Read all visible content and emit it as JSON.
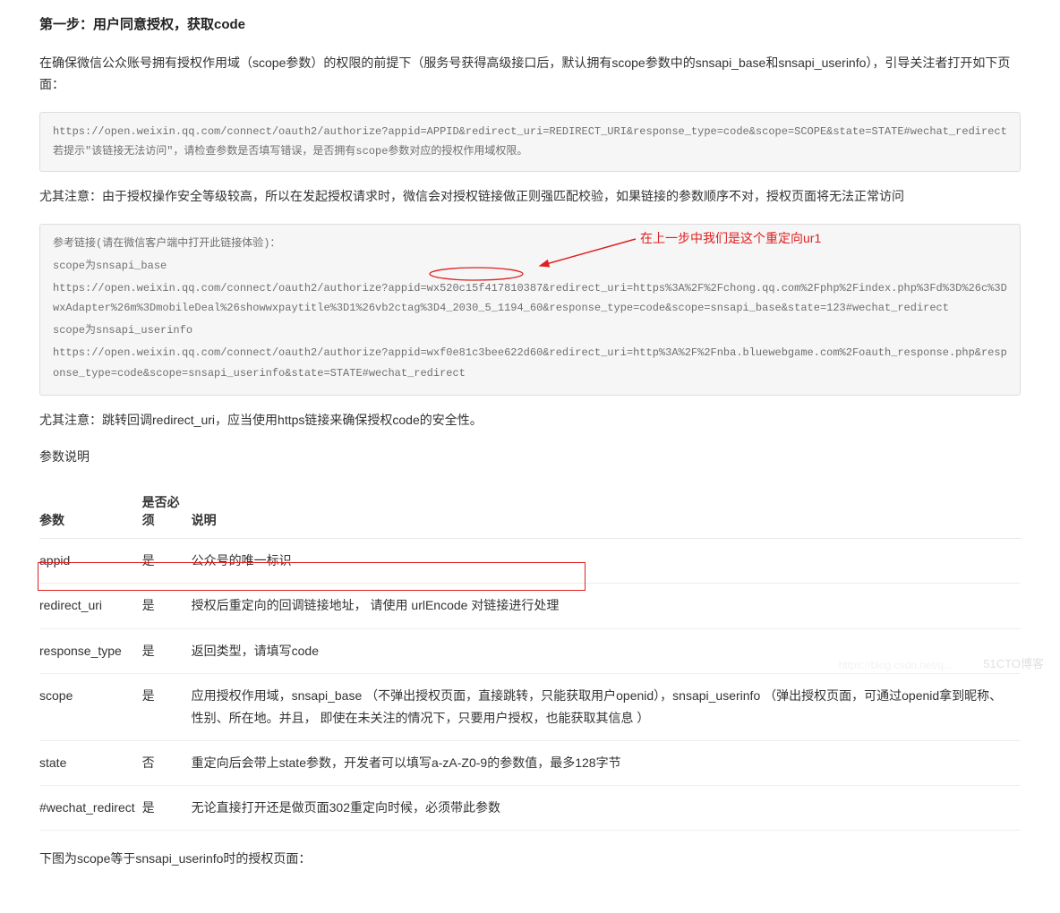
{
  "step_title": "第一步：用户同意授权，获取code",
  "intro_para": "在确保微信公众账号拥有授权作用域（scope参数）的权限的前提下（服务号获得高级接口后，默认拥有scope参数中的snsapi_base和snsapi_userinfo），引导关注者打开如下页面：",
  "code_box_1": "https://open.weixin.qq.com/connect/oauth2/authorize?appid=APPID&redirect_uri=REDIRECT_URI&response_type=code&scope=SCOPE&state=STATE#wechat_redirect 若提示\"该链接无法访问\"，请检查参数是否填写错误，是否拥有scope参数对应的授权作用域权限。",
  "note_1": "尤其注意：由于授权操作安全等级较高，所以在发起授权请求时，微信会对授权链接做正则强匹配校验，如果链接的参数顺序不对，授权页面将无法正常访问",
  "ref_block": {
    "l1": "参考链接(请在微信客户端中打开此链接体验)：",
    "l2": "scope为snsapi_base",
    "l3": "https://open.weixin.qq.com/connect/oauth2/authorize?appid=wx520c15f417810387&redirect_uri=https%3A%2F%2Fchong.qq.com%2Fphp%2Findex.php%3Fd%3D%26c%3DwxAdapter%26m%3DmobileDeal%26showwxpaytitle%3D1%26vb2ctag%3D4_2030_5_1194_60&response_type=code&scope=snsapi_base&state=123#wechat_redirect",
    "l4": "scope为snsapi_userinfo",
    "l5": "https://open.weixin.qq.com/connect/oauth2/authorize?appid=wxf0e81c3bee622d60&redirect_uri=http%3A%2F%2Fnba.bluewebgame.com%2Foauth_response.php&response_type=code&scope=snsapi_userinfo&state=STATE#wechat_redirect"
  },
  "annotation_text": "在上一步中我们是这个重定向ur1",
  "note_2": "尤其注意：跳转回调redirect_uri，应当使用https链接来确保授权code的安全性。",
  "param_heading": "参数说明",
  "table": {
    "headers": {
      "param": "参数",
      "required": "是否必须",
      "desc": "说明"
    },
    "rows": [
      {
        "param": "appid",
        "required": "是",
        "desc": "公众号的唯一标识"
      },
      {
        "param": "redirect_uri",
        "required": "是",
        "desc": "授权后重定向的回调链接地址， 请使用 urlEncode 对链接进行处理"
      },
      {
        "param": "response_type",
        "required": "是",
        "desc": "返回类型，请填写code"
      },
      {
        "param": "scope",
        "required": "是",
        "desc": "应用授权作用域，snsapi_base （不弹出授权页面，直接跳转，只能获取用户openid），snsapi_userinfo （弹出授权页面，可通过openid拿到昵称、性别、所在地。并且， 即使在未关注的情况下，只要用户授权，也能获取其信息 ）"
      },
      {
        "param": "state",
        "required": "否",
        "desc": "重定向后会带上state参数，开发者可以填写a-zA-Z0-9的参数值，最多128字节"
      },
      {
        "param": "#wechat_redirect",
        "required": "是",
        "desc": "无论直接打开还是做页面302重定向时候，必须带此参数"
      }
    ]
  },
  "bottom_para": "下图为scope等于snsapi_userinfo时的授权页面：",
  "watermark_main": "51CTO博客",
  "watermark_sub": "https://blog.csdn.net/q..."
}
